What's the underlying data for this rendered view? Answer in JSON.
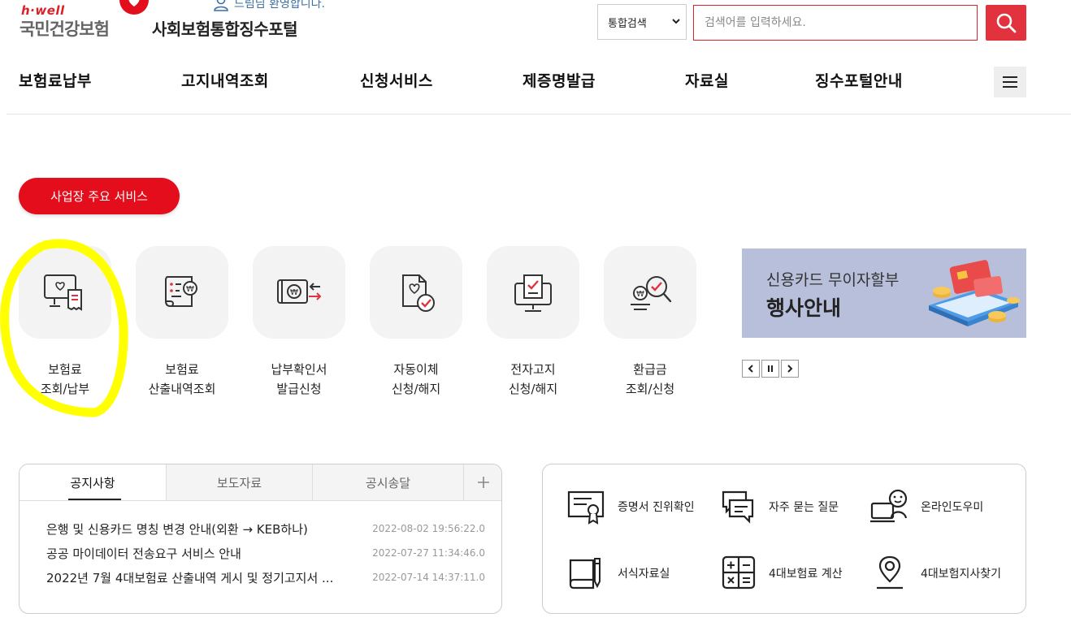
{
  "header": {
    "logo_hwell": "h·well",
    "logo_name": "국민건강보험",
    "portal_title": "사회보험통합징수포털",
    "welcome": "드림님 환영합니다.",
    "search_scope": "통합검색",
    "search_placeholder": "검색어를 입력하세요."
  },
  "nav": {
    "items": [
      "보험료납부",
      "고지내역조회",
      "신청서비스",
      "제증명발급",
      "자료실",
      "징수포털안내"
    ]
  },
  "services": {
    "title": "사업장 주요 서비스",
    "items": [
      {
        "line1": "보험료",
        "line2": "조회/납부",
        "icon": "monitor-receipt-icon"
      },
      {
        "line1": "보험료",
        "line2": "산출내역조회",
        "icon": "document-won-icon"
      },
      {
        "line1": "납부확인서",
        "line2": "발급신청",
        "icon": "card-transfer-icon"
      },
      {
        "line1": "자동이체",
        "line2": "신청/해지",
        "icon": "document-check-icon"
      },
      {
        "line1": "전자고지",
        "line2": "신청/해지",
        "icon": "monitor-document-check-icon"
      },
      {
        "line1": "환급금",
        "line2": "조회/신청",
        "icon": "coins-magnifier-icon"
      }
    ]
  },
  "banner": {
    "line1": "신용카드 무이자할부",
    "line2": "행사안내"
  },
  "notice": {
    "tabs": [
      "공지사항",
      "보도자료",
      "공시송달"
    ],
    "rows": [
      {
        "title": "은행 및 신용카드 명칭 변경 안내(외환 → KEB하나)",
        "date": "2022-08-02 19:56:22.0"
      },
      {
        "title": "공공 마이데이터 전송요구 서비스 안내",
        "date": "2022-07-27 11:34:46.0"
      },
      {
        "title": "2022년 7월 4대보험료 산출내역 게시 및 정기고지서 ...",
        "date": "2022-07-14 14:37:11.0"
      }
    ]
  },
  "quick_links": [
    {
      "label": "증명서 진위확인",
      "icon": "certificate-icon"
    },
    {
      "label": "자주 묻는 질문",
      "icon": "chat-bubbles-icon"
    },
    {
      "label": "온라인도우미",
      "icon": "online-helper-icon"
    },
    {
      "label": "서식자료실",
      "icon": "book-pencil-icon"
    },
    {
      "label": "4대보험료 계산",
      "icon": "calculator-icon"
    },
    {
      "label": "4대보험지사찾기",
      "icon": "location-pin-icon"
    }
  ],
  "colors": {
    "brand_red": "#e30d1c",
    "search_red": "#e2323d",
    "highlight_yellow": "#ffff00",
    "banner_bg": "#b7bfdb"
  }
}
